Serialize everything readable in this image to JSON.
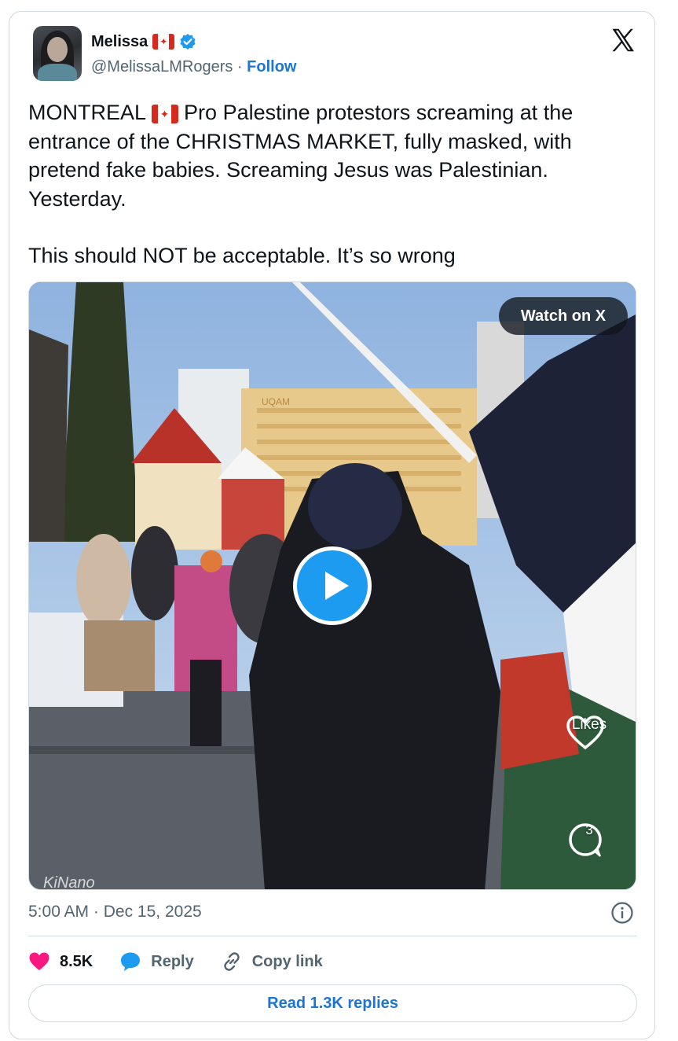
{
  "author": {
    "name": "Melissa",
    "name_flag": "canada-flag-icon",
    "handle": "@MelissaLMRogers",
    "separator": "·",
    "follow_label": "Follow",
    "verified": true
  },
  "tweet": {
    "line1_before_flag": "MONTREAL",
    "line1_after_flag": "Pro Palestine protestors screaming at the entrance of the CHRISTMAS MARKET, fully masked, with pretend fake babies. Screaming Jesus was Palestinian. Yesterday.",
    "line2": "This should NOT be acceptable. It’s so wrong"
  },
  "media": {
    "watch_label": "Watch on X",
    "sign_text": "UQAM",
    "overlay_likes_label": "Likes",
    "overlay_comments_count": "3",
    "watermark": "KiNano"
  },
  "meta": {
    "time": "5:00 AM",
    "separator": "·",
    "date": "Dec 15, 2025"
  },
  "actions": {
    "likes_count": "8.5K",
    "reply_label": "Reply",
    "copy_link_label": "Copy link"
  },
  "read_replies_label": "Read 1.3K replies",
  "colors": {
    "link_blue": "#1d75d1",
    "play_blue": "#1d9bf0",
    "heart_pink": "#f91880",
    "text_primary": "#0f1419",
    "text_secondary": "#536471",
    "border": "#cfd9de"
  }
}
